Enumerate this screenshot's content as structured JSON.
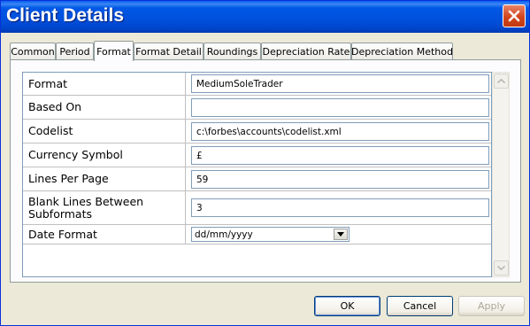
{
  "window": {
    "title": "Client Details"
  },
  "tabs": [
    {
      "label": "Common"
    },
    {
      "label": "Period"
    },
    {
      "label": "Format"
    },
    {
      "label": "Format Detail"
    },
    {
      "label": "Roundings"
    },
    {
      "label": "Depreciation Rate"
    },
    {
      "label": "Depreciation Method"
    }
  ],
  "active_tab": "Format",
  "fields": [
    {
      "label": "Format",
      "value": "MediumSoleTrader"
    },
    {
      "label": "Based On",
      "value": ""
    },
    {
      "label": "Codelist",
      "value": "c:\\forbes\\accounts\\codelist.xml"
    },
    {
      "label": "Currency Symbol",
      "value": "£"
    },
    {
      "label": "Lines Per Page",
      "value": "59"
    },
    {
      "label": "Blank Lines Between Subformats",
      "value": "3"
    },
    {
      "label": "Date Format",
      "value": "dd/mm/yyyy"
    }
  ],
  "buttons": {
    "ok": "OK",
    "cancel": "Cancel",
    "apply": "Apply"
  },
  "icons": {
    "close": "close-icon",
    "scroll_up": "scroll-up-arrow-icon",
    "scroll_down": "scroll-down-arrow-icon",
    "dropdown": "chevron-down-icon"
  },
  "colors": {
    "titlebar": "#0050dc",
    "close_button": "#d1451c",
    "dialog_bg": "#ece9d8"
  }
}
